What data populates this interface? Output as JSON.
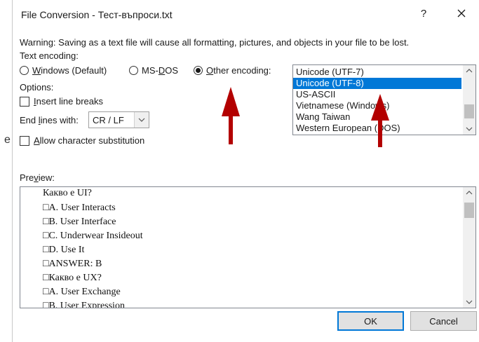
{
  "dialog": {
    "title": "File Conversion - Тест-въпроси.txt",
    "help_label": "?",
    "warning": "Warning: Saving as a text file will cause all formatting, pictures, and objects in your file to be lost."
  },
  "encoding": {
    "label": "Text encoding:",
    "radios": [
      {
        "label_u": "W",
        "label_rest": "indows (Default)",
        "selected": false
      },
      {
        "label_pre": "MS-",
        "label_u": "D",
        "label_rest": "OS",
        "selected": false
      },
      {
        "label_u": "O",
        "label_rest": "ther encoding:",
        "selected": true
      }
    ],
    "options": [
      "Unicode (UTF-7)",
      "Unicode (UTF-8)",
      "US-ASCII",
      "Vietnamese (Windows)",
      "Wang Taiwan",
      "Western European (DOS)"
    ],
    "selected_option": "Unicode (UTF-8)"
  },
  "options": {
    "label": "Options:",
    "insert_line_breaks_u": "I",
    "insert_line_breaks_rest": "nsert line breaks",
    "end_lines_label_pre": "End ",
    "end_lines_label_u": "l",
    "end_lines_label_rest": "ines with:",
    "end_lines_value": "CR / LF",
    "allow_sub_u": "A",
    "allow_sub_rest": "llow character substitution"
  },
  "preview": {
    "label_pre": "Pre",
    "label_u": "v",
    "label_rest": "iew:",
    "lines": [
      "Какво е UI?",
      "□A. User Interacts",
      "□B. User Interface",
      "□C. Underwear Insideout",
      "□D. Use It",
      "□ANSWER: B",
      "□Какво е UX?",
      "□A. User Exchange",
      "□B. User Expression"
    ]
  },
  "buttons": {
    "ok": "OK",
    "cancel": "Cancel"
  },
  "left_edge_glyph": "e",
  "colors": {
    "selection": "#0078d7",
    "annotation_arrow": "#b30000"
  }
}
